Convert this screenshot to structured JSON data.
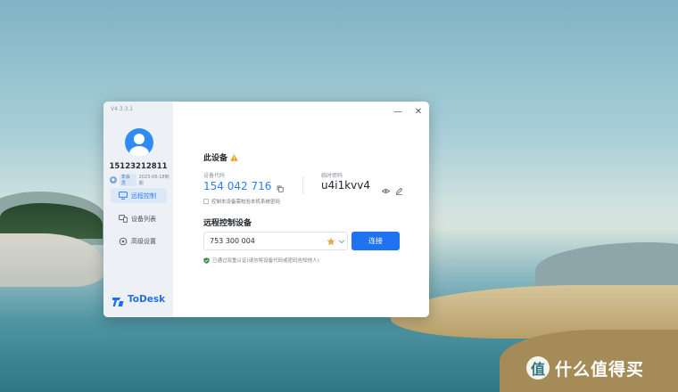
{
  "window": {
    "version": "V4.3.3.1",
    "controls": {
      "minimize": "—",
      "close": "✕"
    }
  },
  "sidebar": {
    "username": "15123212811",
    "member": {
      "badge": "年会员",
      "expiry": "2023-06-18到期"
    },
    "nav": [
      {
        "label": "远程控制",
        "icon": "monitor-icon",
        "active": true
      },
      {
        "label": "设备列表",
        "icon": "devices-icon",
        "active": false
      },
      {
        "label": "高级设置",
        "icon": "gear-icon",
        "active": false
      }
    ],
    "brand": "ToDesk"
  },
  "this_device": {
    "title": "此设备",
    "device_code_label": "设备代码",
    "device_code": "154 042 716",
    "temp_password_label": "临时密码",
    "temp_password": "u4i1kvv4",
    "checkbox_label": "控制本设备需校验本机系统密码"
  },
  "remote": {
    "title": "远程控制设备",
    "input_value": "753 300 004",
    "connect_label": "连接",
    "status": "已通过双重认证(请勿将设备代码或密码告知他人)"
  },
  "watermark": {
    "logo": "值",
    "text": "什么值得买"
  },
  "colors": {
    "accent": "#1f72f0",
    "warning": "#f0a020",
    "sidebar_bg": "#edf1f6"
  }
}
